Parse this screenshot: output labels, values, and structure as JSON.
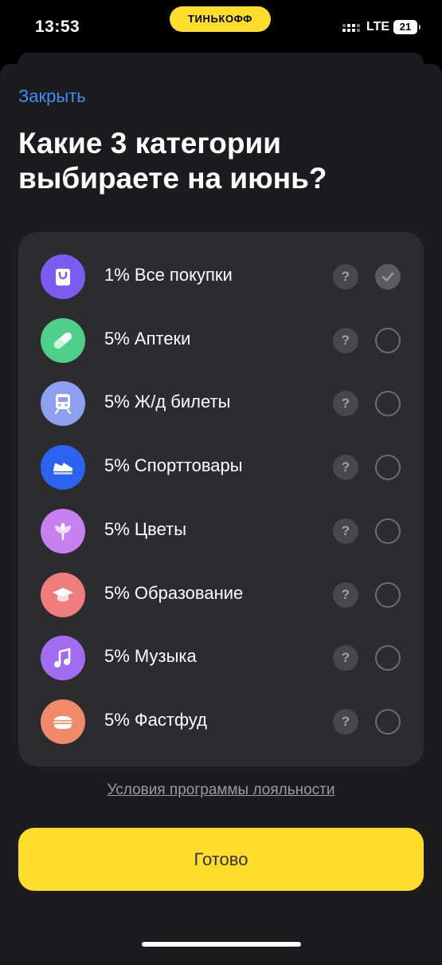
{
  "status_bar": {
    "time": "13:53",
    "brand": "ТИНЬКОФФ",
    "network": "LTE",
    "battery": "21"
  },
  "sheet": {
    "close_label": "Закрыть",
    "title_line1": "Какие 3 категории",
    "title_line2": "выбираете на июнь?"
  },
  "categories": [
    {
      "label": "1% Все покупки",
      "icon": "shopping-bag-icon",
      "color": "#7a5cf0",
      "selected": true
    },
    {
      "label": "5% Аптеки",
      "icon": "pill-icon",
      "color": "#4fd08a",
      "selected": false
    },
    {
      "label": "5% Ж/д билеты",
      "icon": "train-icon",
      "color": "#8f9ff0",
      "selected": false
    },
    {
      "label": "5% Спорттовары",
      "icon": "sneaker-icon",
      "color": "#2b63f0",
      "selected": false
    },
    {
      "label": "5% Цветы",
      "icon": "flower-icon",
      "color": "#c680f0",
      "selected": false
    },
    {
      "label": "5% Образование",
      "icon": "graduation-cap-icon",
      "color": "#ef7d7d",
      "selected": false
    },
    {
      "label": "5% Музыка",
      "icon": "music-note-icon",
      "color": "#a26cf0",
      "selected": false
    },
    {
      "label": "5% Фастфуд",
      "icon": "burger-icon",
      "color": "#f08a6a",
      "selected": false
    }
  ],
  "help_label": "?",
  "footer": {
    "terms_link": "Условия программы лояльности",
    "done_label": "Готово"
  },
  "colors": {
    "accent_yellow": "#ffdd2d",
    "link_blue": "#428bf9",
    "card_bg": "#2c2c2e",
    "sheet_bg": "#1c1c1e"
  }
}
